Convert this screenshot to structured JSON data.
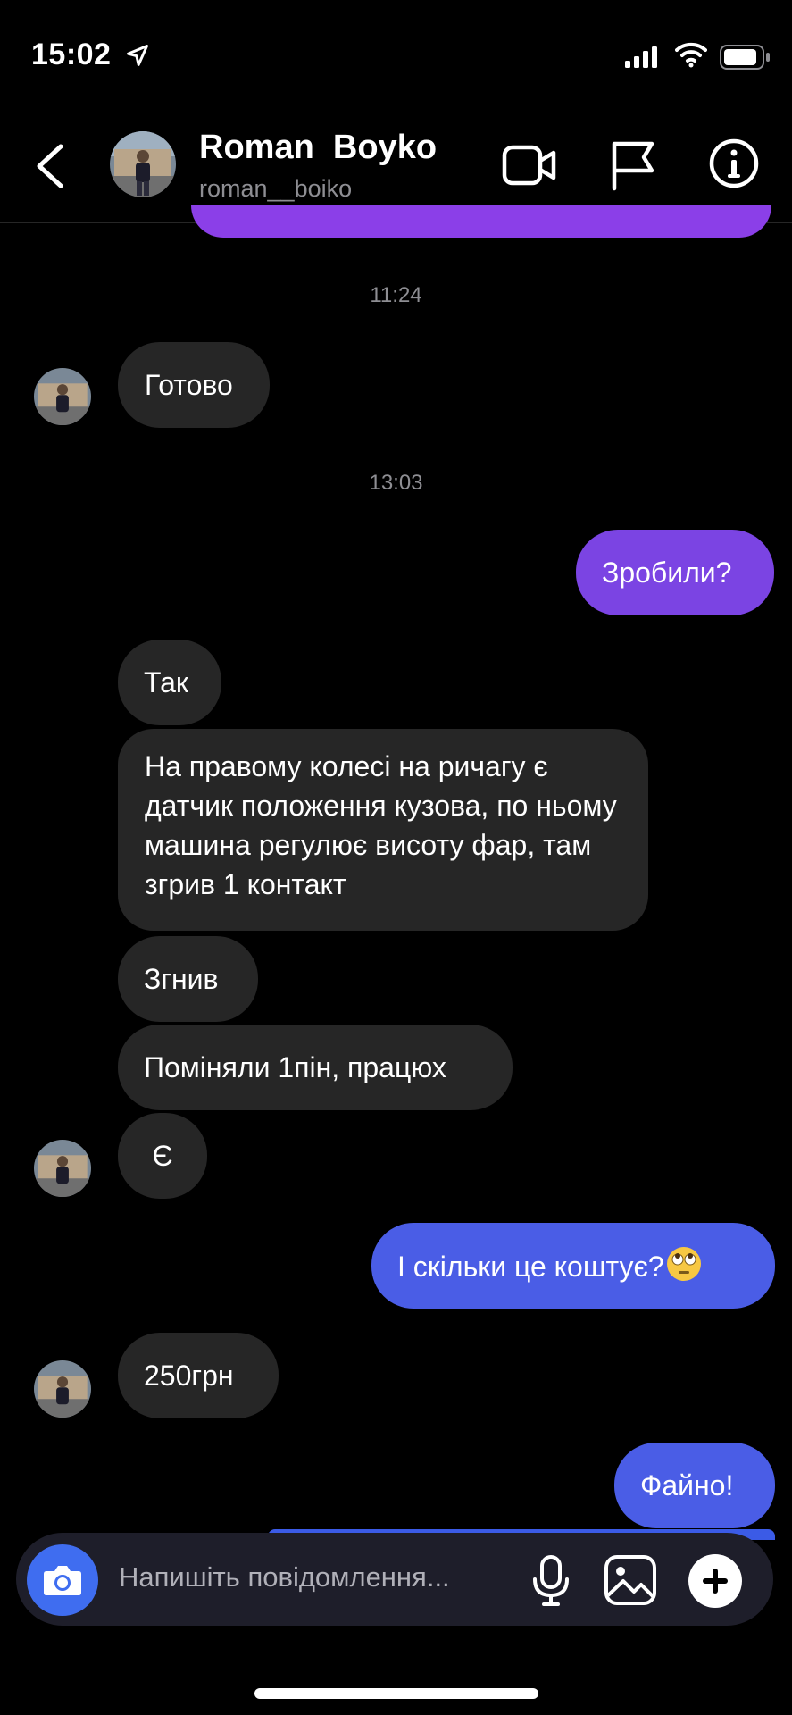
{
  "status_bar": {
    "time": "15:02"
  },
  "header": {
    "name": "Roman  Boyko",
    "username": "roman__boiko",
    "icons": [
      "back-icon",
      "avatar",
      "video-call-icon",
      "flag-icon",
      "info-icon"
    ]
  },
  "messages": {
    "timestamp_1": "11:24",
    "msg_gotovo": "Готово",
    "timestamp_2": "13:03",
    "msg_zrobyly": "Зробили?",
    "msg_tak": "Так",
    "msg_long": "На правому колесі на ричагу є датчик положення кузова, по ньому машина регулює висоту фар, там згрив 1 контакт",
    "msg_zgnyv": "Згнив",
    "msg_pominialy": "Поміняли 1пін, працюх",
    "msg_ye": "Є",
    "msg_skilky": "І скільки це коштує?",
    "msg_skilky_emoji": "face-with-rolling-eyes",
    "msg_250": "250грн",
    "msg_faino": "Файно!"
  },
  "composer": {
    "placeholder": "Напишіть повідомлення..."
  },
  "colors": {
    "purple_bubble": "#7b44e3",
    "blue_bubble": "#4a5de6",
    "incoming_bubble": "#262626"
  }
}
